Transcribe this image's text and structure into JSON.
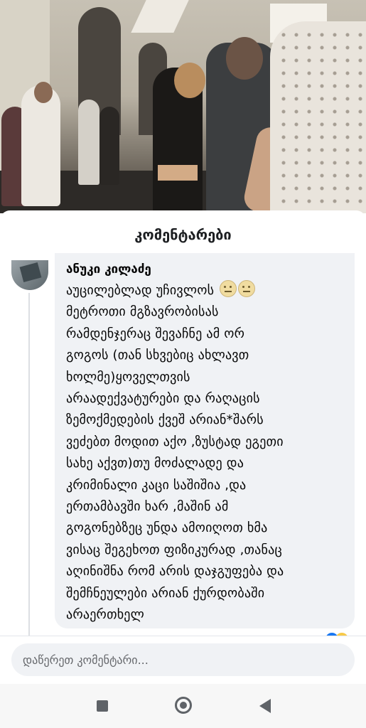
{
  "sheet": {
    "title": "კომენტარები"
  },
  "comment": {
    "author": "ანუკი კილაძე",
    "first_line": "აუცილებლად უჩივლოს",
    "body": "მეტროთი მგზავრობისას\nრამდენჯერაც შევაჩნე ამ ორ\nგოგოს (თან სხვებიც ახლავთ\nხოლმე)ყოველთვის\nარაადექვატურები და რაღაცის\nზემოქმედების ქვეშ არიან*შარს\nვეძებთ მოდით აქო ,ზუსტად ეგეთი\nსახე აქვთ)თუ მოძალადე და\nკრიმინალი კაცი საშიშია ,და\nერთამბავში ხარ ,მაშინ ამ\nგოგონებზეც უნდა ამოიღოთ ხმა\nვისაც შეგეხოთ ფიზიკურად ,თანაც\nაღინიშნა რომ არის დაჯგუფება და\nშემჩნეულები არიან ქურდობაში\nარაერთხელ",
    "emojis": [
      "neutral-face-emoji",
      "neutral-face-emoji"
    ]
  },
  "composer": {
    "placeholder": "დაწერეთ კომენტარი..."
  },
  "navbar": {
    "icons": [
      "recents-square-icon",
      "home-circle-icon",
      "back-triangle-icon"
    ]
  },
  "colors": {
    "bubble_bg": "#f0f2f5",
    "text": "#050505",
    "muted": "#65676b",
    "reaction_blue": "#1877f2",
    "reaction_yellow": "#f7c948"
  }
}
